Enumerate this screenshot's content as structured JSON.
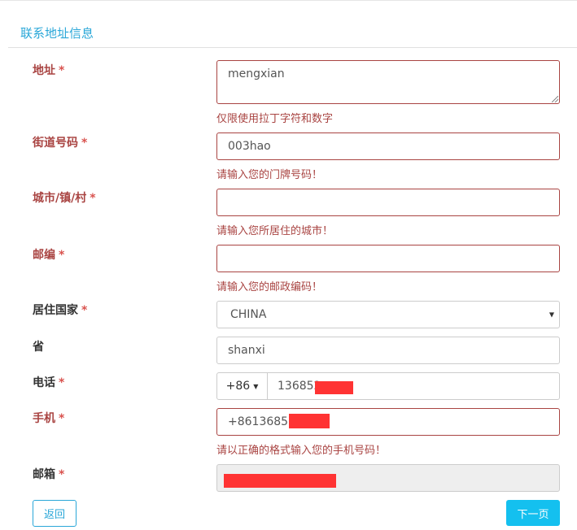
{
  "section": {
    "title": "联系地址信息"
  },
  "required_mark": "*",
  "address": {
    "label": "地址",
    "value": "mengxian",
    "help": "仅限使用拉丁字符和数字"
  },
  "street": {
    "label": "街道号码",
    "value": "003hao",
    "help": "请输入您的门牌号码！"
  },
  "city": {
    "label": "城市/镇/村",
    "value": "",
    "help": "请输入您所居住的城市！"
  },
  "postcode": {
    "label": "邮编",
    "value": "",
    "help": "请输入您的邮政编码！"
  },
  "country": {
    "label": "居住国家",
    "selected": "CHINA"
  },
  "province": {
    "label": "省",
    "value": "shanxi"
  },
  "phone": {
    "label": "电话",
    "prefix": "+86",
    "value_visible": "136852"
  },
  "mobile": {
    "label": "手机",
    "value_visible": "+861368527",
    "help": "请以正确的格式输入您的手机号码！"
  },
  "email": {
    "label": "邮箱"
  },
  "buttons": {
    "back": "返回",
    "next": "下一页"
  },
  "colors": {
    "accent": "#2aa7d8",
    "primary_button": "#14c0ef",
    "error": "#a94442",
    "redaction": "#ff3333"
  }
}
